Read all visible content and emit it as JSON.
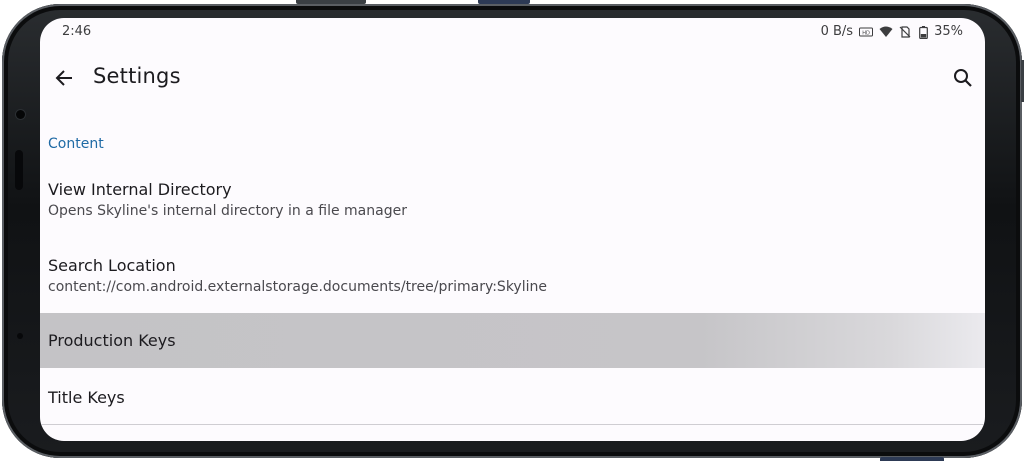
{
  "status_bar": {
    "time": "2:46",
    "net_speed": "0 B/s",
    "battery": "35%",
    "icons": [
      "hd-icon",
      "wifi-icon",
      "no-sim-icon",
      "battery-icon"
    ]
  },
  "app_bar": {
    "title": "Settings",
    "back_icon": "arrow-back-icon",
    "search_icon": "search-icon"
  },
  "sections": [
    {
      "header": "Content",
      "items": [
        {
          "title": "View Internal Directory",
          "summary": "Opens Skyline's internal directory in a file manager"
        },
        {
          "title": "Search Location",
          "summary": "content://com.android.externalstorage.documents/tree/primary:Skyline"
        },
        {
          "title": "Production Keys",
          "pressed": true
        },
        {
          "title": "Title Keys"
        }
      ]
    }
  ],
  "colors": {
    "accent": "#1f6aa5",
    "pressed_bg": "#c4c3c6",
    "screen_bg": "#fdfbfe",
    "frame": "#101214"
  }
}
